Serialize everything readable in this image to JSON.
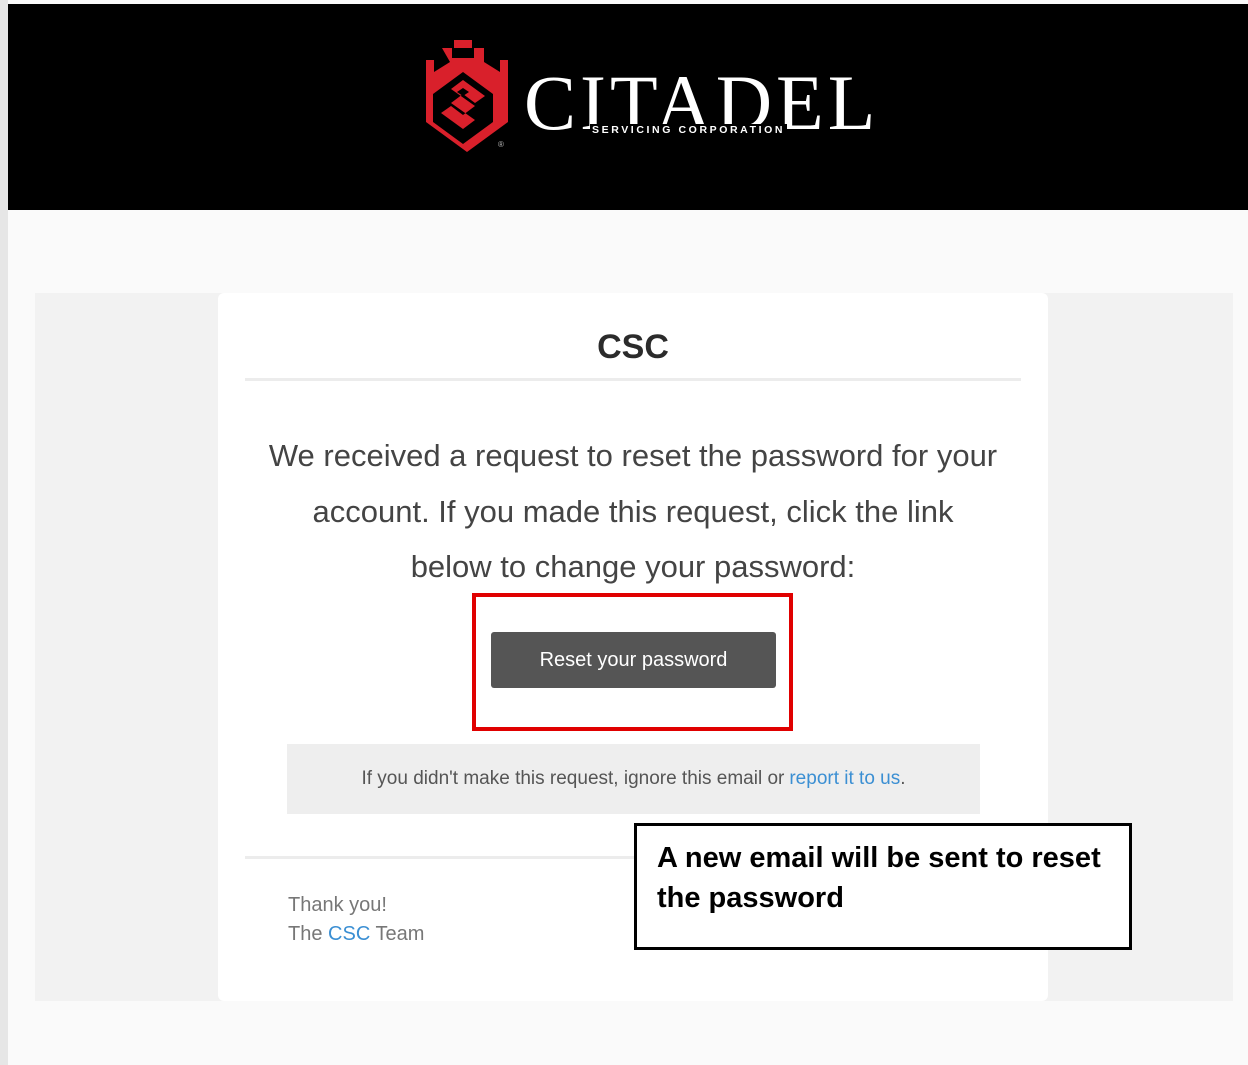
{
  "header": {
    "brand_name": "CITADEL",
    "brand_subtitle": "SERVICING CORPORATION",
    "registered_mark": "®",
    "logo_icon": "citadel-shield-icon",
    "brand_color": "#d9202b"
  },
  "email": {
    "title": "CSC",
    "message": "We received a request to reset the password for your account. If you made this request, click the link below to change your password:",
    "button_label": "Reset your password",
    "notice_text": "If you didn't make this request, ignore this email or",
    "notice_link": "report it to us",
    "notice_end": ".",
    "signoff_line1": "Thank you!",
    "signoff_prefix": "The",
    "signoff_link": "CSC",
    "signoff_suffix": "Team",
    "link_color": "#3b8fd3",
    "button_color": "#555555"
  },
  "annotation": {
    "callout_text": "A new email will be sent to reset the password",
    "highlight_color": "#e00000"
  }
}
